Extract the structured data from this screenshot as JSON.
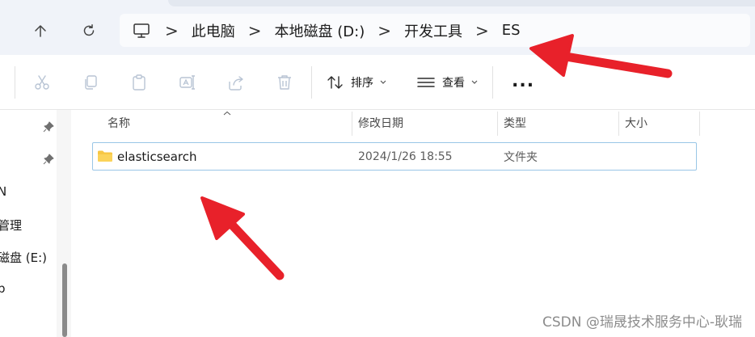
{
  "breadcrumb": {
    "items": [
      "此电脑",
      "本地磁盘 (D:)",
      "开发工具",
      "ES"
    ],
    "separator": ">"
  },
  "toolbar": {
    "sort_label": "排序",
    "view_label": "查看",
    "more_label": "..."
  },
  "columns": {
    "name": "名称",
    "date_modified": "修改日期",
    "type": "类型",
    "size": "大小"
  },
  "files": [
    {
      "name": "elasticsearch",
      "date_modified": "2024/1/26 18:55",
      "type": "文件夹",
      "size": ""
    }
  ],
  "nav_pane": {
    "items": [
      "N",
      "管理",
      "磁盘 (E:)",
      "p"
    ]
  },
  "watermark": "CSDN @瑞晟技术服务中心-耿瑞",
  "colors": {
    "annotation_arrow": "#e8212a",
    "selection_border": "#99c6e6",
    "folder": "#f7c744"
  },
  "icons": [
    "computer-icon",
    "up-arrow-icon",
    "refresh-icon",
    "cut-icon",
    "copy-icon",
    "paste-icon",
    "rename-icon",
    "share-icon",
    "delete-icon",
    "sort-icon",
    "view-icon",
    "pin-icon",
    "folder-icon"
  ]
}
